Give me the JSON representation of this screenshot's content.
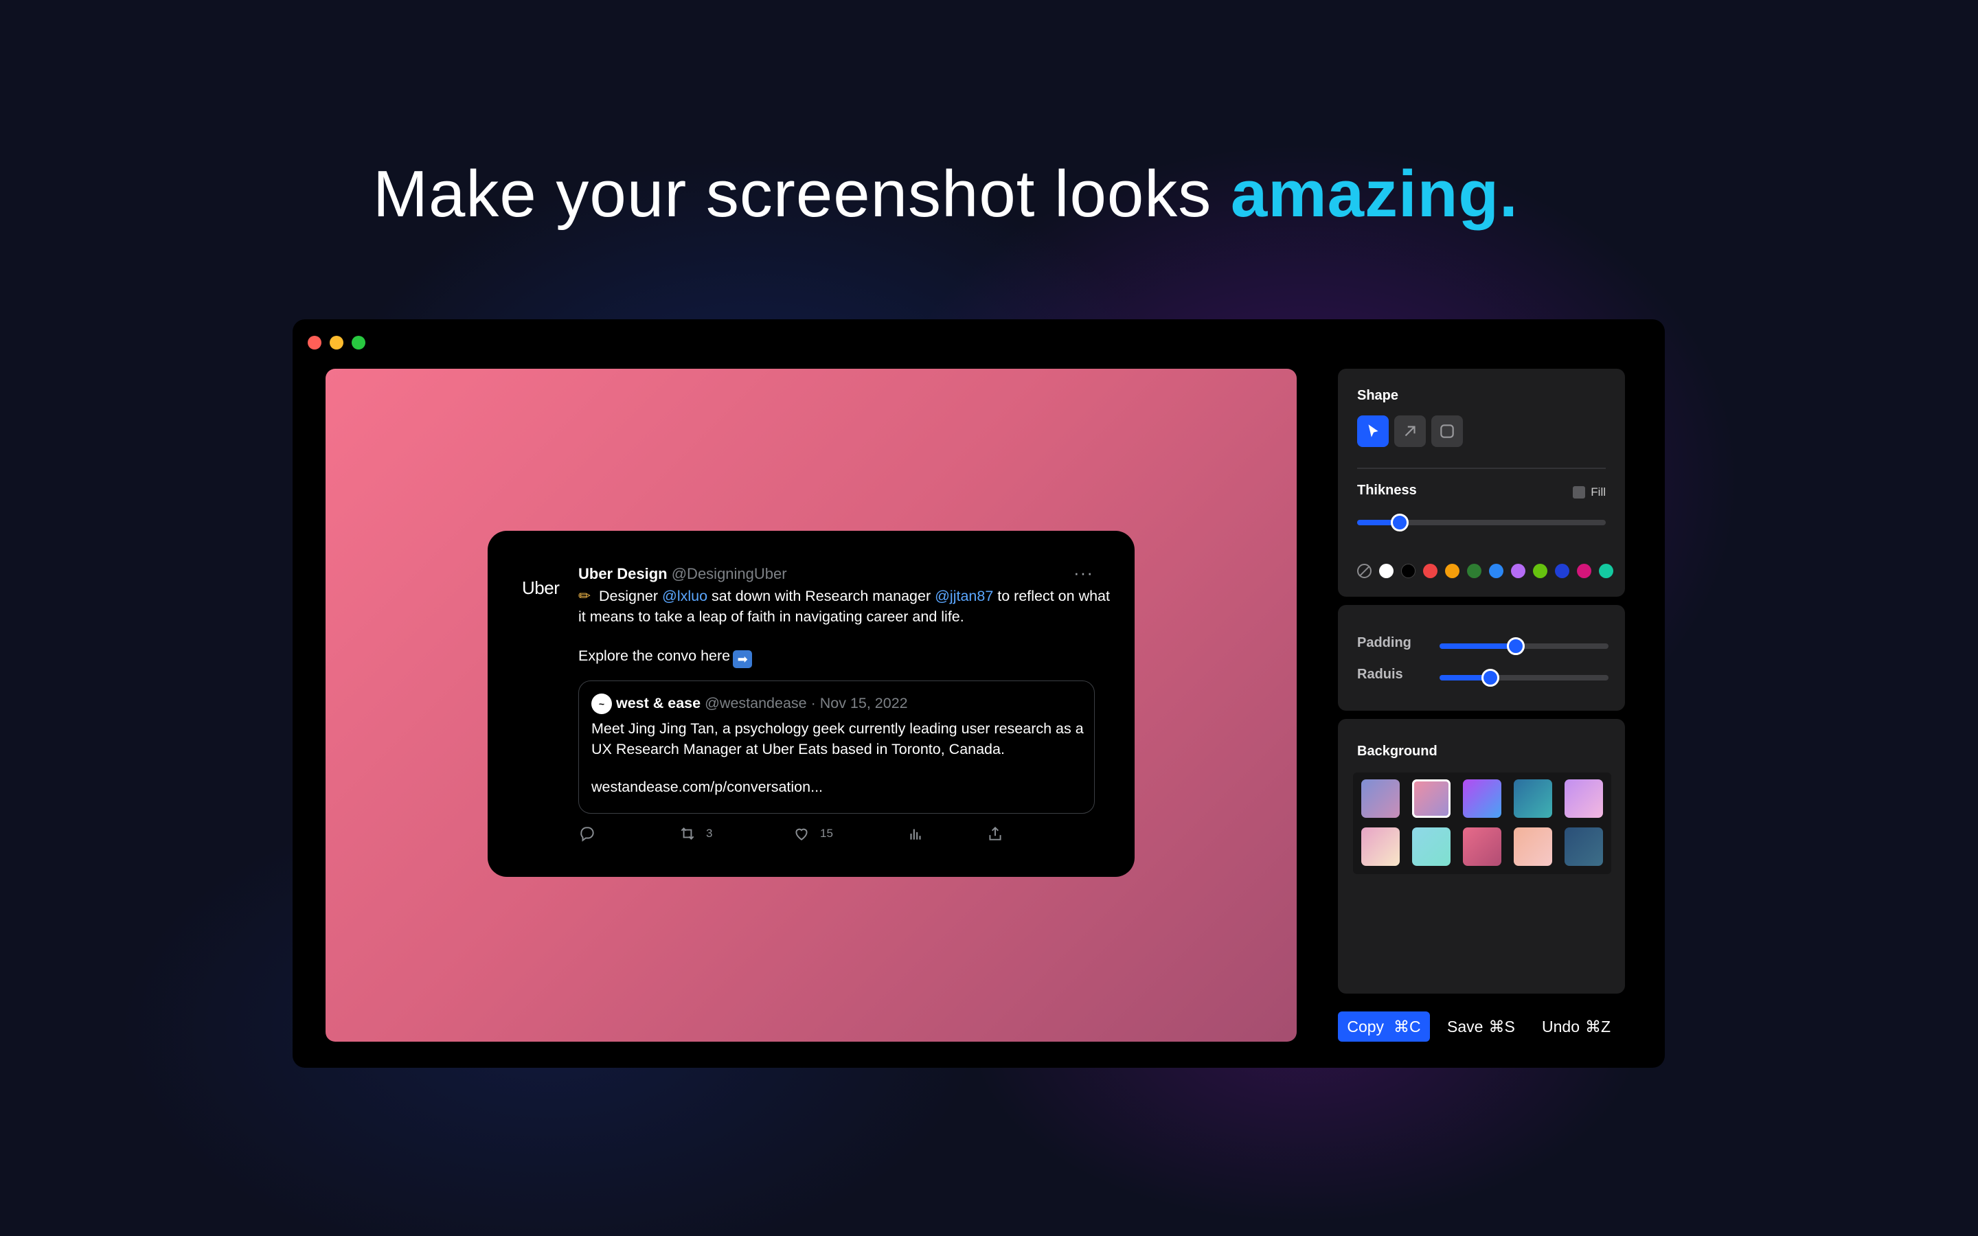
{
  "hero": {
    "title_main": "Make your screenshot looks ",
    "title_accent": "amazing."
  },
  "tweet": {
    "logo": "Uber",
    "name": "Uber Design",
    "handle": "@DesigningUber",
    "more": "···",
    "body_p1": " Designer ",
    "mention1": "@lxluo",
    "body_p2": " sat down with Research manager ",
    "mention2": "@jjtan87",
    "body_p3": " to reflect on what it means to take a leap of faith in navigating career and life.",
    "explore": "Explore the convo here",
    "quote": {
      "name": "west & ease",
      "meta": "@westandease · Nov 15, 2022",
      "body": "Meet Jing Jing Tan, a psychology geek currently leading user research as a UX Research Manager at Uber Eats based in Toronto, Canada.",
      "link": "westandease.com/p/conversation..."
    },
    "retweets": "3",
    "likes": "15"
  },
  "panel": {
    "shape_label": "Shape",
    "thickness_label": "Thikness",
    "fill_label": "Fill",
    "thickness_value": 0.17,
    "padding_label": "Padding",
    "padding_value": 0.45,
    "radius_label": "Raduis",
    "radius_value": 0.3,
    "background_label": "Background",
    "colors": [
      "#ffffff",
      "#000000",
      "#ef4444",
      "#f59e0b",
      "#2e7d32",
      "#2b87f5",
      "#b56cf5",
      "#66c20f",
      "#1f3fd6",
      "#d4157a",
      "#14c9a0"
    ],
    "selected_background": 1
  },
  "footer": {
    "copy_label": "Copy",
    "copy_shortcut": "⌘C",
    "save_label": "Save",
    "save_shortcut": "⌘S",
    "undo_label": "Undo",
    "undo_shortcut": "⌘Z"
  }
}
